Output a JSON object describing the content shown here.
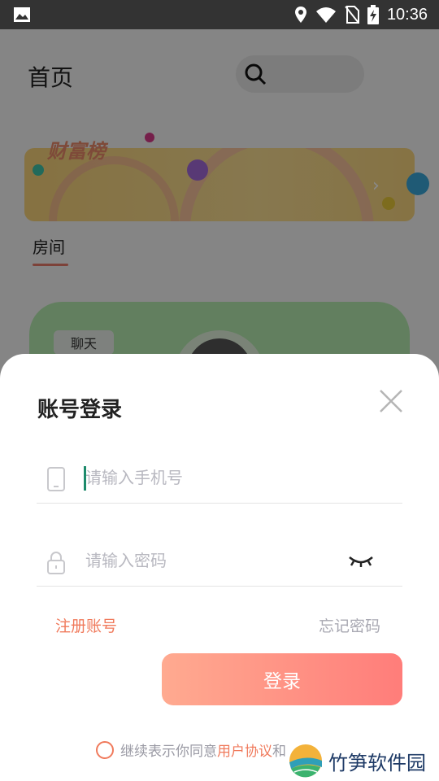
{
  "status_bar": {
    "time": "10:36",
    "icons": [
      "gallery-icon",
      "location-icon",
      "wifi-icon",
      "no-sim-icon",
      "battery-charging-icon"
    ]
  },
  "home": {
    "title": "首页",
    "search_icon": "search-icon",
    "banner_title": "财富榜",
    "banner_arrow": "›",
    "tab_label": "房间",
    "card_tag": "聊天"
  },
  "login": {
    "title": "账号登录",
    "phone_placeholder": "请输入手机号",
    "phone_value": "",
    "password_placeholder": "请输入密码",
    "password_value": "",
    "register_link": "注册账号",
    "forgot_link": "忘记密码",
    "login_button": "登录",
    "agreement_prefix": "继续表示你同意",
    "agreement_link": "用户协议",
    "agreement_suffix": "和"
  },
  "watermark": {
    "text": "竹笋软件园"
  },
  "colors": {
    "accent": "#f07a5c",
    "button_start": "#ffaa90",
    "button_end": "#ff7d7a",
    "status_bar": "#333333",
    "cursor": "#1d8a6b"
  }
}
